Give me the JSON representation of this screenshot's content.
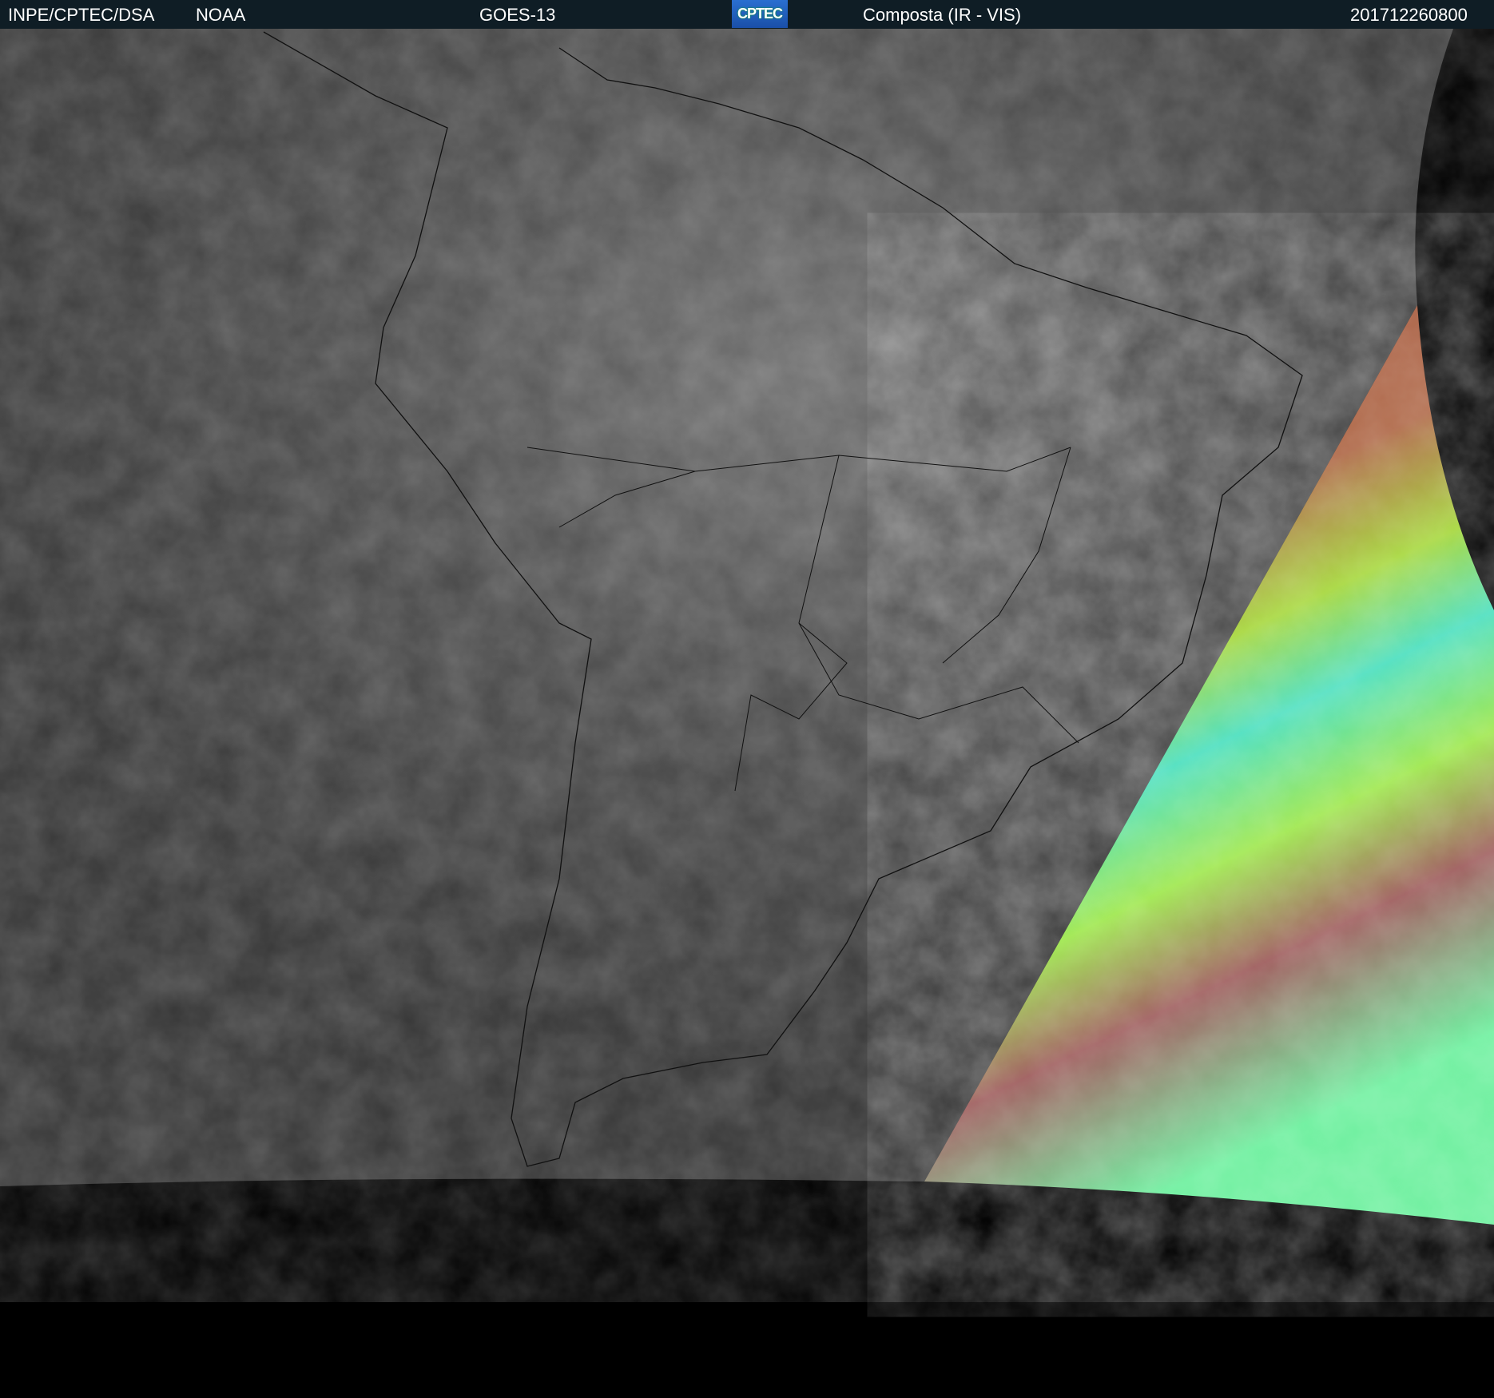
{
  "header": {
    "org": "INPE/CPTEC/DSA",
    "agency": "NOAA",
    "satellite": "GOES-13",
    "logo_text": "CPTEC",
    "product": "Composta (IR - VIS)",
    "timestamp": "201712260800"
  },
  "colors": {
    "header_bg": "#0f1d25",
    "ir_gray": "#3a3a3a",
    "vis_red": "#a0564a",
    "vis_green": "#9de04a",
    "vis_cyan": "#4ee0c0"
  }
}
